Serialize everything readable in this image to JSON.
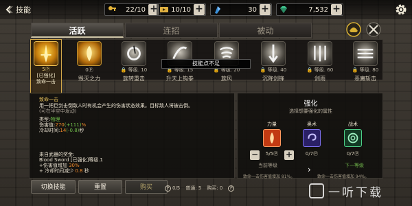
{
  "header": {
    "back_label": "技能",
    "resources": [
      {
        "value": "22/10",
        "icon": "key-icon",
        "color": "#e4b43a"
      },
      {
        "value": "10/10",
        "icon": "ticket-icon",
        "color": "#e0b040"
      },
      {
        "value": "30",
        "icon": "crystal-icon",
        "color": "#3a8fd8"
      },
      {
        "value": "7,532",
        "icon": "gem-icon",
        "color": "#3fbf8c"
      }
    ]
  },
  "tabs": [
    {
      "label": "活跃",
      "active": true
    },
    {
      "label": "连招",
      "active": false
    },
    {
      "label": "被动",
      "active": false
    }
  ],
  "toast": "技能点不足",
  "skills": [
    {
      "name": "致命一击",
      "cost": "5",
      "tag": "[已强化]",
      "selected": true
    },
    {
      "name": "毁灭之力",
      "cost": "0",
      "level": ""
    },
    {
      "name": "旋转重击",
      "level": "等级. 10"
    },
    {
      "name": "升天上钩拳",
      "level": "等级. 15"
    },
    {
      "name": "旋风",
      "level": "等级. 20"
    },
    {
      "name": "沉降剑锋",
      "level": "等级. 40"
    },
    {
      "name": "剑雨",
      "level": "等级. 60"
    },
    {
      "name": "恶魔斩击",
      "level": "等级. 80"
    }
  ],
  "description": {
    "title": "致命一击",
    "text1": "用一把巨剑击倒敌人时有机会产生的伤害状态效果。目标敌人将被击倒。",
    "text2": "(可在半空中发动)",
    "type_label": "类型:",
    "type_value": "物理",
    "damage_label": "伤害值:",
    "damage_value": "270",
    "damage_bonus": "(+111)",
    "damage_unit": "%",
    "cooldown_label": "冷却时间:",
    "cooldown_value": "14",
    "cooldown_bonus": "(-0.8)",
    "cooldown_unit": "秒",
    "weapon_title": "来自武器的奖金:",
    "weapon_name": "Blood Sword [已强化]等级.1",
    "weapon_bonus1": "+伤害值增加 ",
    "weapon_bonus1_value": "30%",
    "weapon_bonus2": "+ 冷却时间减少 ",
    "weapon_bonus2_value": "0.8",
    "weapon_bonus2_unit": " 秒"
  },
  "upgrade": {
    "title": "强化",
    "subtitle": "选择想要强化的属性",
    "attrs": [
      {
        "label": "力量",
        "count": "5/5",
        "color": "#c23a12"
      },
      {
        "label": "奥术",
        "count": "0/7",
        "color": "#5a49c9"
      },
      {
        "label": "战术",
        "count": "0/7",
        "color": "#2c9c5c"
      }
    ],
    "current_label": "当前等级",
    "next_label": "下一等级",
    "current_effect": "致命一击伤害值增加 81%。",
    "next_effect": "致命一击伤害值增加 94%。"
  },
  "buttons": {
    "switch": "切换技能",
    "reset": "重置",
    "buy": "购买"
  },
  "points": {
    "skill_points": "0/5",
    "normal": "普通: 5",
    "purchase": "购买: 0"
  },
  "watermark": "一听下载"
}
